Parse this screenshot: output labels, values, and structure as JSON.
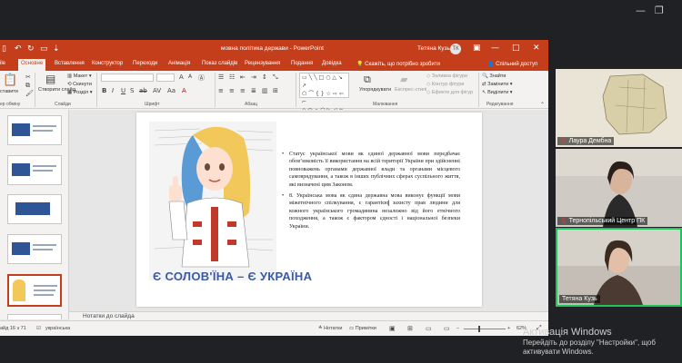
{
  "ppt": {
    "doc_title": "мовна політика держави - PowerPoint",
    "user": "Тетяна Кузь",
    "avatar": "ТК",
    "tabs": [
      "Основне",
      "Вставлення",
      "Конструктор",
      "Переходи",
      "Анімація",
      "Показ слайдів",
      "Рецензування",
      "Подання",
      "Довідка"
    ],
    "tab_file": "ile",
    "tell_me": "Скажіть, що потрібно зробити",
    "share": "Спільний доступ"
  },
  "ribbon": {
    "paste": "ставити",
    "clipboard": "ер обміну",
    "format_painter": "Формат за зразком",
    "new_slide": "Створити слайд",
    "layout": "Макет",
    "reset": "Скинути",
    "section": "Розділ",
    "group_slides": "Слайди",
    "group_font": "Шрифт",
    "group_paragraph": "Абзац",
    "group_drawing": "Малювання",
    "arrange": "Упорядкувати",
    "quick_styles": "Експрес-стилі",
    "shape_fill": "Заливка фігури",
    "shape_outline": "Контур фігури",
    "shape_effects": "Ефекти для фігур",
    "find": "Знайти",
    "replace": "Замінити",
    "select": "Виділити",
    "group_editing": "Редагування"
  },
  "slide": {
    "bullet1": "Статус української мови як єдиної державної мови передбачає обов’язковість її використання на всій території України при здійсненні повноважень органами державної влади та органами місцевого самоврядування, а також в інших публічних сферах суспільного життя, які визначені цим Законом.",
    "bullet2": "8. Українська мова як єдина державна мова виконує функції мови міжетнічного спілкування, є гарантією захисту прав людини для кожного українського громадянина незалежно від його етнічного походження, а також є фактором єдності і національної безпеки України.",
    "slogan": "Є СОЛОВ'ЇНА – Є УКРАЇНА"
  },
  "notes": "Нотатки до слайда",
  "status": {
    "slide_no": "айд 16 з 71",
    "language": "українська",
    "notes_btn": "Нотатки",
    "comments_btn": "Примітки",
    "zoom": "62%"
  },
  "participants": [
    {
      "name": "Лаура Дембна"
    },
    {
      "name": "Тернопільський Центр ПК"
    },
    {
      "name": "Тетяна Кузь"
    }
  ],
  "activation": {
    "title": "Активація Windows",
    "line1": "Перейдіть до розділу \"Настройки\", щоб",
    "line2": "активувати Windows."
  },
  "colors": {
    "accent": "#c43e1c",
    "speaker_border": "#21c35b"
  }
}
